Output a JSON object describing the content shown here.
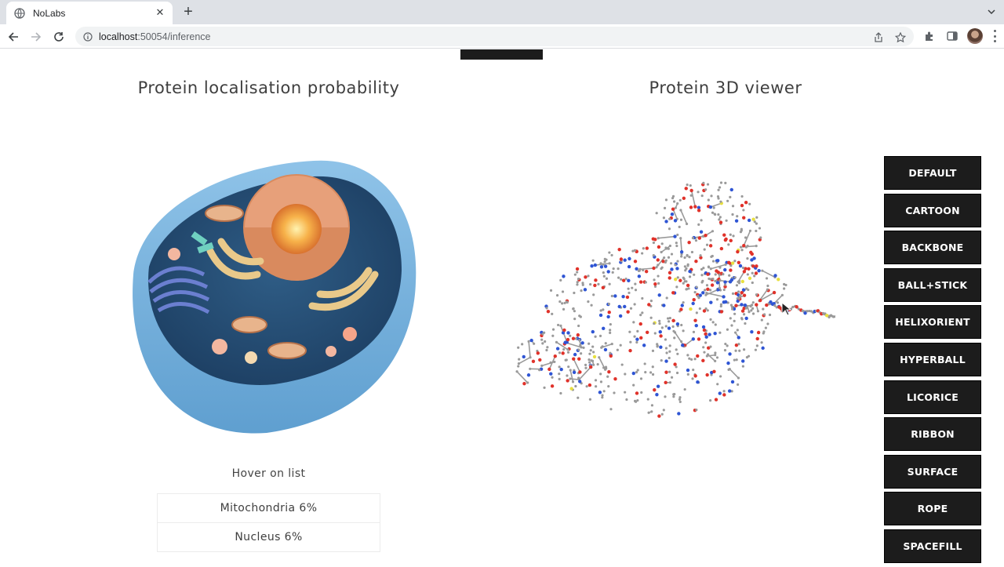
{
  "browser": {
    "tab_title": "NoLabs",
    "url_host": "localhost",
    "url_rest": ":50054/inference",
    "tab_close": "✕",
    "new_tab": "+"
  },
  "left_section": {
    "title": "Protein localisation probability",
    "hover_label": "Hover on list",
    "items": [
      {
        "label": "Mitochondria 6%"
      },
      {
        "label": "Nucleus 6%"
      }
    ]
  },
  "right_section": {
    "title": "Protein 3D viewer",
    "buttons": [
      {
        "label": "DEFAULT"
      },
      {
        "label": "CARTOON"
      },
      {
        "label": "BACKBONE"
      },
      {
        "label": "BALL+STICK"
      },
      {
        "label": "HELIXORIENT"
      },
      {
        "label": "HYPERBALL"
      },
      {
        "label": "LICORICE"
      },
      {
        "label": "RIBBON"
      },
      {
        "label": "SURFACE"
      },
      {
        "label": "ROPE"
      },
      {
        "label": "SPACEFILL"
      }
    ]
  },
  "colors": {
    "button_bg": "#1c1c1c",
    "atom_carbon": "#9a9a9a",
    "atom_oxygen": "#e0322a",
    "atom_nitrogen": "#2f55d4",
    "atom_sulfur": "#e8e040"
  }
}
